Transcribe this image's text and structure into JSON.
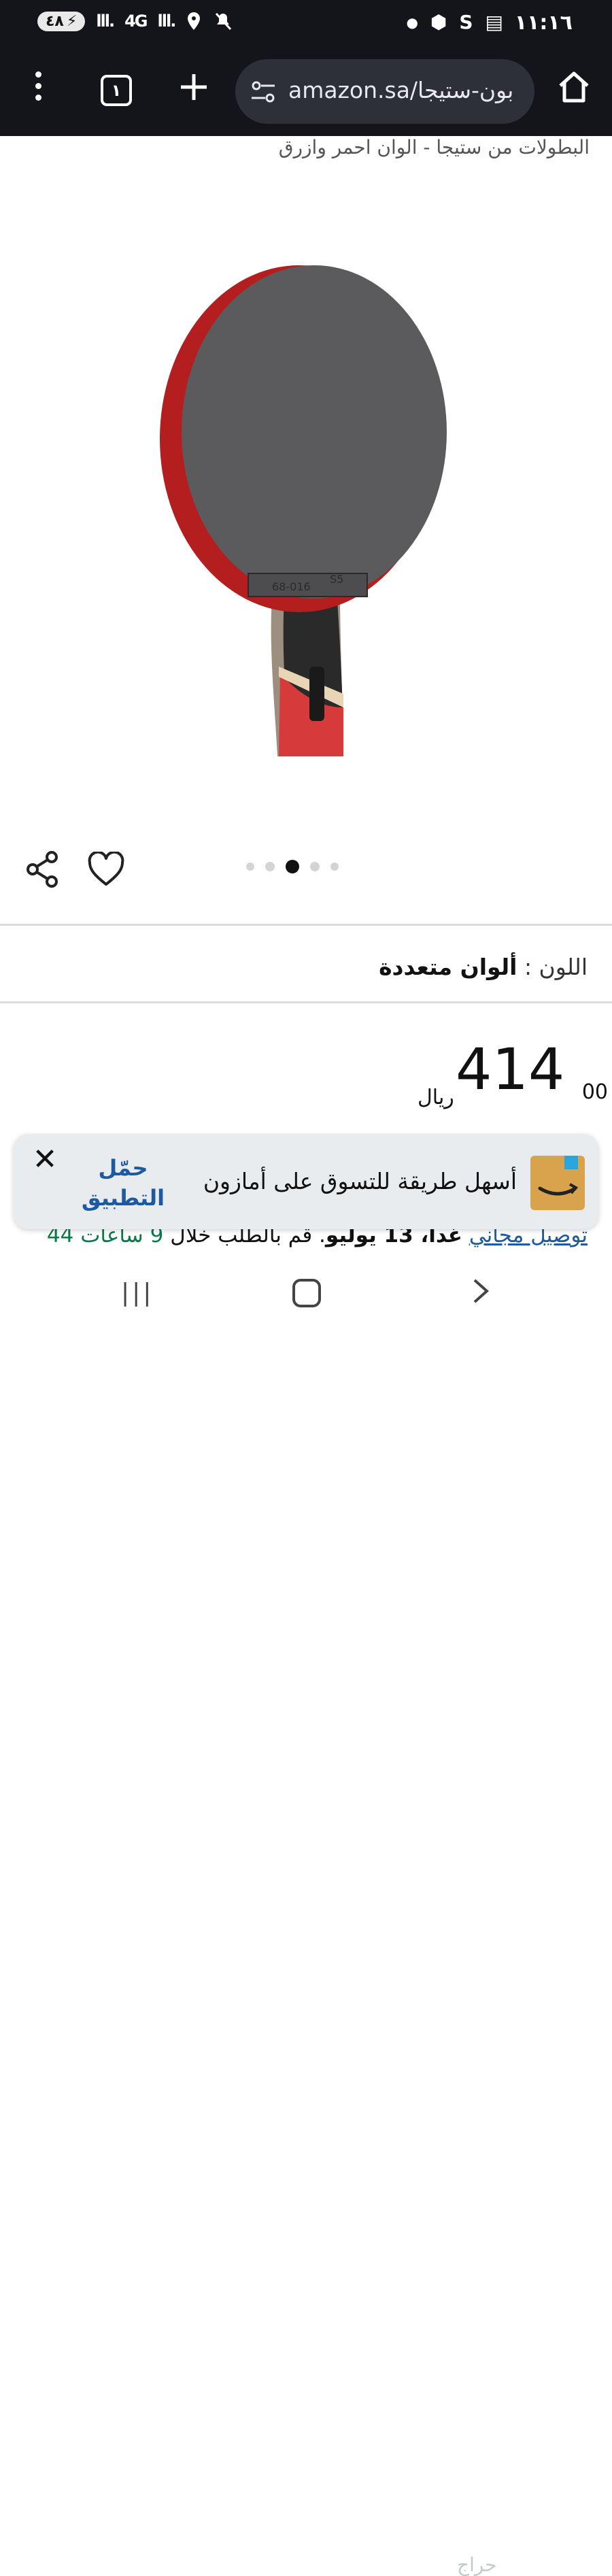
{
  "status_bar": {
    "time": "١١:١٦",
    "battery": "٤٨",
    "network_label": "4G"
  },
  "browser": {
    "url": "amazon.sa/بون-ستيجا",
    "tab_count": "١"
  },
  "product": {
    "title_line": "البطولات من ستيجا - الوان احمر وازرق",
    "image_dots": {
      "count": 5,
      "active_index": 2
    },
    "color_label": "اللون :",
    "color_value": "ألوان متعددة",
    "price_integer": "414",
    "price_fraction": "00",
    "currency": "ريال"
  },
  "app_banner": {
    "close": "✕",
    "cta_line1": "حمّل",
    "cta_line2": "التطبيق",
    "text": "أسهل طريقة للتسوق على أمازون"
  },
  "delivery": {
    "link": "توصيل مجاني",
    "date_bold": "غداً، 13 يوليو",
    "middle": ". قم بالطلب خلال ",
    "time_green": "9 ساعات 44"
  },
  "watermark": "حراج",
  "colors": {
    "status_bg": "#14151a",
    "url_pill": "#2e3038",
    "link_blue": "#1e5aa0",
    "banner_bg": "#e9ecef"
  }
}
